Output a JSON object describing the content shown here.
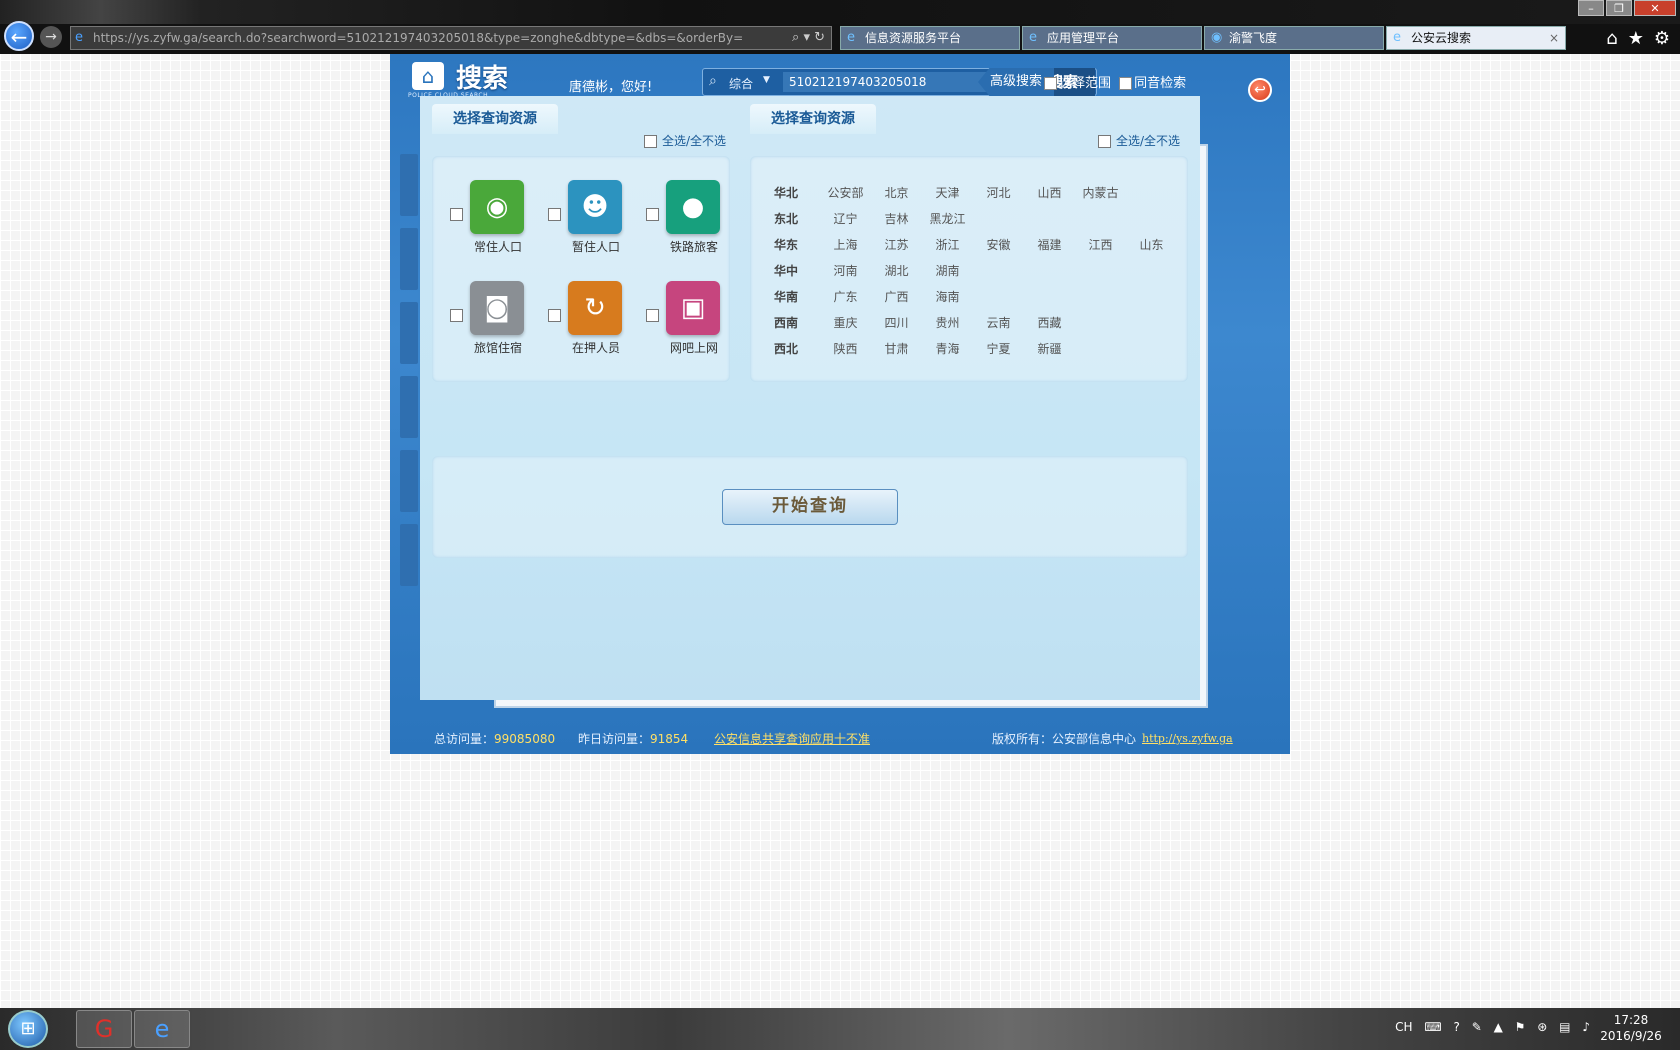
{
  "browser": {
    "url": "https://ys.zyfw.ga/search.do?searchword=510212197403205018&type=zonghe&dbtype=&dbs=&orderBy=",
    "tabs": [
      {
        "label": "信息资源服务平台"
      },
      {
        "label": "应用管理平台"
      },
      {
        "label": "渝警飞度"
      },
      {
        "label": "公安云搜索"
      }
    ],
    "tab_close": "×"
  },
  "header": {
    "logo_text": "搜索",
    "logo_sub": "POLICE CLOUD SEARCH",
    "greeting": "唐德彬，您好!",
    "scope": "综合",
    "search_value": "510212197403205018",
    "search_label": "搜索",
    "advanced_label": "高级搜索",
    "opt_range": "选择范围",
    "opt_homophone": "同音检索"
  },
  "left_section": {
    "title": "选择查询资源",
    "select_all": "全选/全不选",
    "resources": [
      {
        "name": "常住人口",
        "color": "#4aa83a",
        "icon": "person-circle-icon"
      },
      {
        "name": "暂住人口",
        "color": "#2c93bf",
        "icon": "people-icon"
      },
      {
        "name": "铁路旅客",
        "color": "#17a07d",
        "icon": "passenger-icon"
      },
      {
        "name": "旅馆住宿",
        "color": "#8a8f94",
        "icon": "camera-icon"
      },
      {
        "name": "在押人员",
        "color": "#d77b1e",
        "icon": "detainee-icon"
      },
      {
        "name": "网吧上网",
        "color": "#c6457e",
        "icon": "computer-icon"
      }
    ]
  },
  "right_section": {
    "title": "选择查询资源",
    "select_all": "全选/全不选",
    "regions": [
      {
        "label": "华北",
        "items": [
          "公安部",
          "北京",
          "天津",
          "河北",
          "山西",
          "内蒙古"
        ]
      },
      {
        "label": "东北",
        "items": [
          "辽宁",
          "吉林",
          "黑龙江"
        ]
      },
      {
        "label": "华东",
        "items": [
          "上海",
          "江苏",
          "浙江",
          "安徽",
          "福建",
          "江西",
          "山东"
        ]
      },
      {
        "label": "华中",
        "items": [
          "河南",
          "湖北",
          "湖南"
        ]
      },
      {
        "label": "华南",
        "items": [
          "广东",
          "广西",
          "海南"
        ]
      },
      {
        "label": "西南",
        "items": [
          "重庆",
          "四川",
          "贵州",
          "云南",
          "西藏"
        ]
      },
      {
        "label": "西北",
        "items": [
          "陕西",
          "甘肃",
          "青海",
          "宁夏",
          "新疆"
        ]
      }
    ]
  },
  "start_button": "开始查询",
  "footer": {
    "total_label": "总访问量：",
    "total_value": "99085080",
    "yesterday_label": "昨日访问量：",
    "yesterday_value": "91854",
    "link": "公安信息共享查询应用十不准",
    "copyright": "版权所有：公安部信息中心",
    "site": "http://ys.zyfw.ga"
  },
  "taskbar": {
    "lang": "CH",
    "time": "17:28",
    "date": "2016/9/26"
  }
}
